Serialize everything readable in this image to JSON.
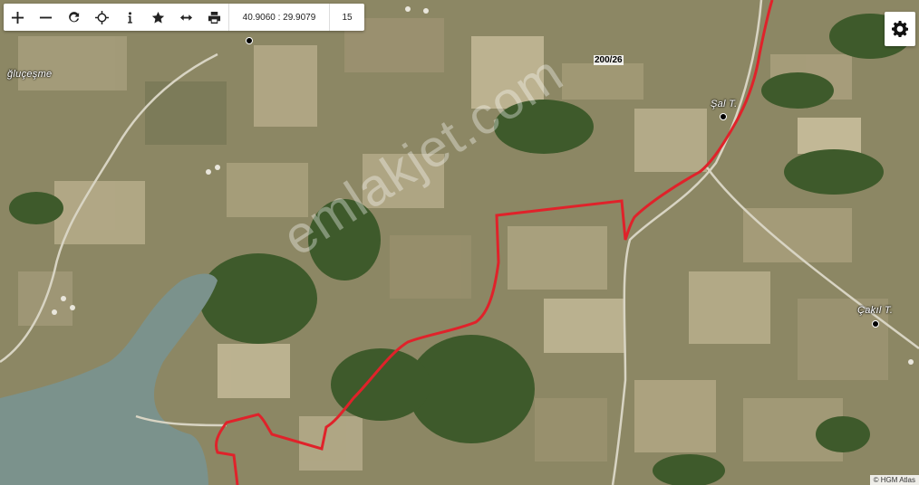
{
  "toolbar": {
    "zoom_in": "+",
    "zoom_out": "−",
    "coordinates": "40.9060 : 29.9079",
    "zoom_level": "15"
  },
  "map": {
    "place_labels": [
      "ğluçeşme",
      "Şal T.",
      "Çakıl T."
    ],
    "parcel_label": "200/26",
    "attribution": "© HGM Atlas",
    "watermark": "emlakjet.com"
  },
  "colors": {
    "route": "#e0222a",
    "farmland": "#8f8a68",
    "forest": "#3f5a2c",
    "water": "#7e9590",
    "road": "#d9d6c8"
  },
  "icons": [
    "plus-icon",
    "minus-icon",
    "refresh-icon",
    "crosshair-icon",
    "info-icon",
    "star-icon",
    "measure-icon",
    "print-icon",
    "gear-icon"
  ]
}
